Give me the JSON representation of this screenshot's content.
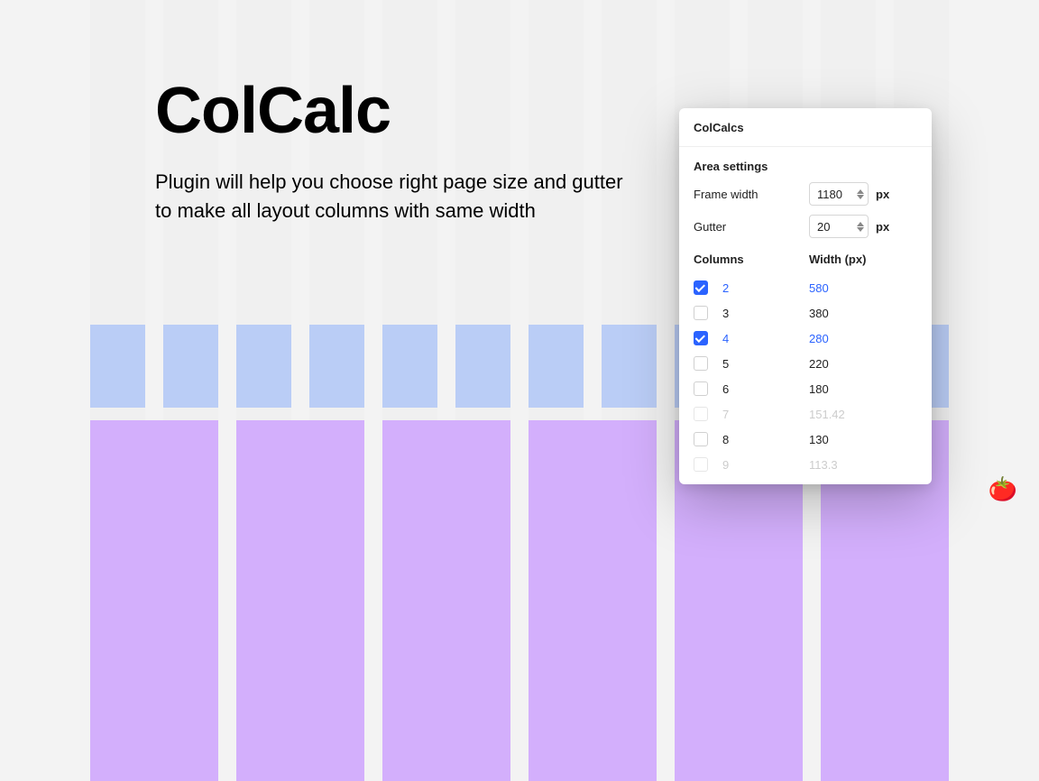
{
  "hero": {
    "title": "ColCalc",
    "subtitle": "Plugin will help you choose right page size and gutter to make all layout columns with same width"
  },
  "panel": {
    "title": "ColCalcs",
    "area_settings_label": "Area settings",
    "frame_width_label": "Frame width",
    "frame_width_value": "1180",
    "gutter_label": "Gutter",
    "gutter_value": "20",
    "unit": "px",
    "columns_header": "Columns",
    "width_header": "Width (px)",
    "rows": [
      {
        "cols": "2",
        "width": "580",
        "checked": true,
        "faded": false
      },
      {
        "cols": "3",
        "width": "380",
        "checked": false,
        "faded": false
      },
      {
        "cols": "4",
        "width": "280",
        "checked": true,
        "faded": false
      },
      {
        "cols": "5",
        "width": "220",
        "checked": false,
        "faded": false
      },
      {
        "cols": "6",
        "width": "180",
        "checked": false,
        "faded": false
      },
      {
        "cols": "7",
        "width": "151.42",
        "checked": false,
        "faded": true
      },
      {
        "cols": "8",
        "width": "130",
        "checked": false,
        "faded": false
      },
      {
        "cols": "9",
        "width": "113.3",
        "checked": false,
        "faded": true
      }
    ]
  },
  "decor": {
    "tomato": "🍅"
  }
}
